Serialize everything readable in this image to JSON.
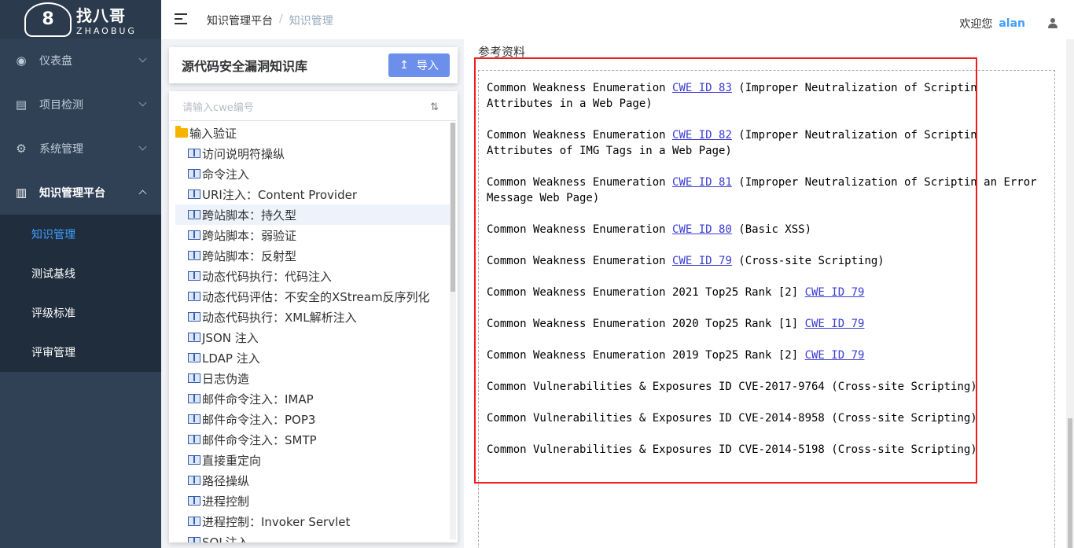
{
  "logo": {
    "mark": "8",
    "name_cn": "找八哥",
    "name_en": "ZHAOBUG"
  },
  "sidebar": {
    "menus": [
      {
        "label": "仪表盘",
        "icon": "dashboard-icon"
      },
      {
        "label": "项目检测",
        "icon": "document-icon"
      },
      {
        "label": "系统管理",
        "icon": "gear-icon"
      },
      {
        "label": "知识管理平台",
        "icon": "book-icon"
      }
    ],
    "submenu": [
      {
        "label": "知识管理"
      },
      {
        "label": "测试基线"
      },
      {
        "label": "评级标准"
      },
      {
        "label": "评审管理"
      }
    ]
  },
  "header": {
    "breadcrumb": [
      "知识管理平台",
      "知识管理"
    ],
    "breadcrumb_sep": "/",
    "welcome": "欢迎您",
    "username": "alan"
  },
  "library": {
    "title": "源代码安全漏洞知识库",
    "import_label": "导入",
    "import_icon": "↥",
    "search_placeholder": "请输入cwe编号",
    "sort_icon": "⇅",
    "root": "输入验证",
    "nodes": [
      "访问说明符操纵",
      "命令注入",
      "URI注入：Content Provider",
      "跨站脚本：持久型",
      "跨站脚本：弱验证",
      "跨站脚本：反射型",
      "动态代码执行：代码注入",
      "动态代码评估：不安全的XStream反序列化",
      "动态代码执行：XML解析注入",
      "JSON 注入",
      "LDAP 注入",
      "日志伪造",
      "邮件命令注入：IMAP",
      "邮件命令注入：POP3",
      "邮件命令注入：SMTP",
      "直接重定向",
      "路径操纵",
      "进程控制",
      "进程控制：Invoker Servlet",
      "SQL注入"
    ]
  },
  "references": {
    "title": "参考资料",
    "items": [
      {
        "prefix": "Common Weakness Enumeration ",
        "link": "CWE ID 83",
        "suffix": " (Improper Neutralization of Scriptin Attributes in a Web Page)"
      },
      {
        "prefix": "Common Weakness Enumeration ",
        "link": "CWE ID 82",
        "suffix": " (Improper Neutralization of Scriptin Attributes of IMG Tags in a Web Page)"
      },
      {
        "prefix": "Common Weakness Enumeration ",
        "link": "CWE ID 81",
        "suffix": " (Improper Neutralization of Scriptin an Error Message Web Page)"
      },
      {
        "prefix": "Common Weakness Enumeration ",
        "link": "CWE ID 80",
        "suffix": " (Basic XSS)"
      },
      {
        "prefix": "Common Weakness Enumeration ",
        "link": "CWE ID 79",
        "suffix": " (Cross-site Scripting)"
      },
      {
        "prefix": "Common Weakness Enumeration 2021 Top25 Rank [2] ",
        "link": "CWE ID 79",
        "suffix": ""
      },
      {
        "prefix": "Common Weakness Enumeration 2020 Top25 Rank [1] ",
        "link": "CWE ID 79",
        "suffix": ""
      },
      {
        "prefix": "Common Weakness Enumeration 2019 Top25 Rank [2] ",
        "link": "CWE ID 79",
        "suffix": ""
      },
      {
        "prefix": "Common Vulnerabilities & Exposures ID CVE-2017-9764 (Cross-site Scripting)",
        "link": "",
        "suffix": ""
      },
      {
        "prefix": "Common Vulnerabilities & Exposures ID CVE-2014-8958 (Cross-site Scripting)",
        "link": "",
        "suffix": ""
      },
      {
        "prefix": "Common Vulnerabilities & Exposures ID CVE-2014-5198 (Cross-site Scripting)",
        "link": "",
        "suffix": ""
      }
    ]
  },
  "colors": {
    "sidebar_bg": "#304156",
    "submenu_bg": "#1f2d3d",
    "accent": "#409eff",
    "import_button": "#6d8fec",
    "highlight_border": "#ef1d1d",
    "link": "#3b3bd4"
  }
}
